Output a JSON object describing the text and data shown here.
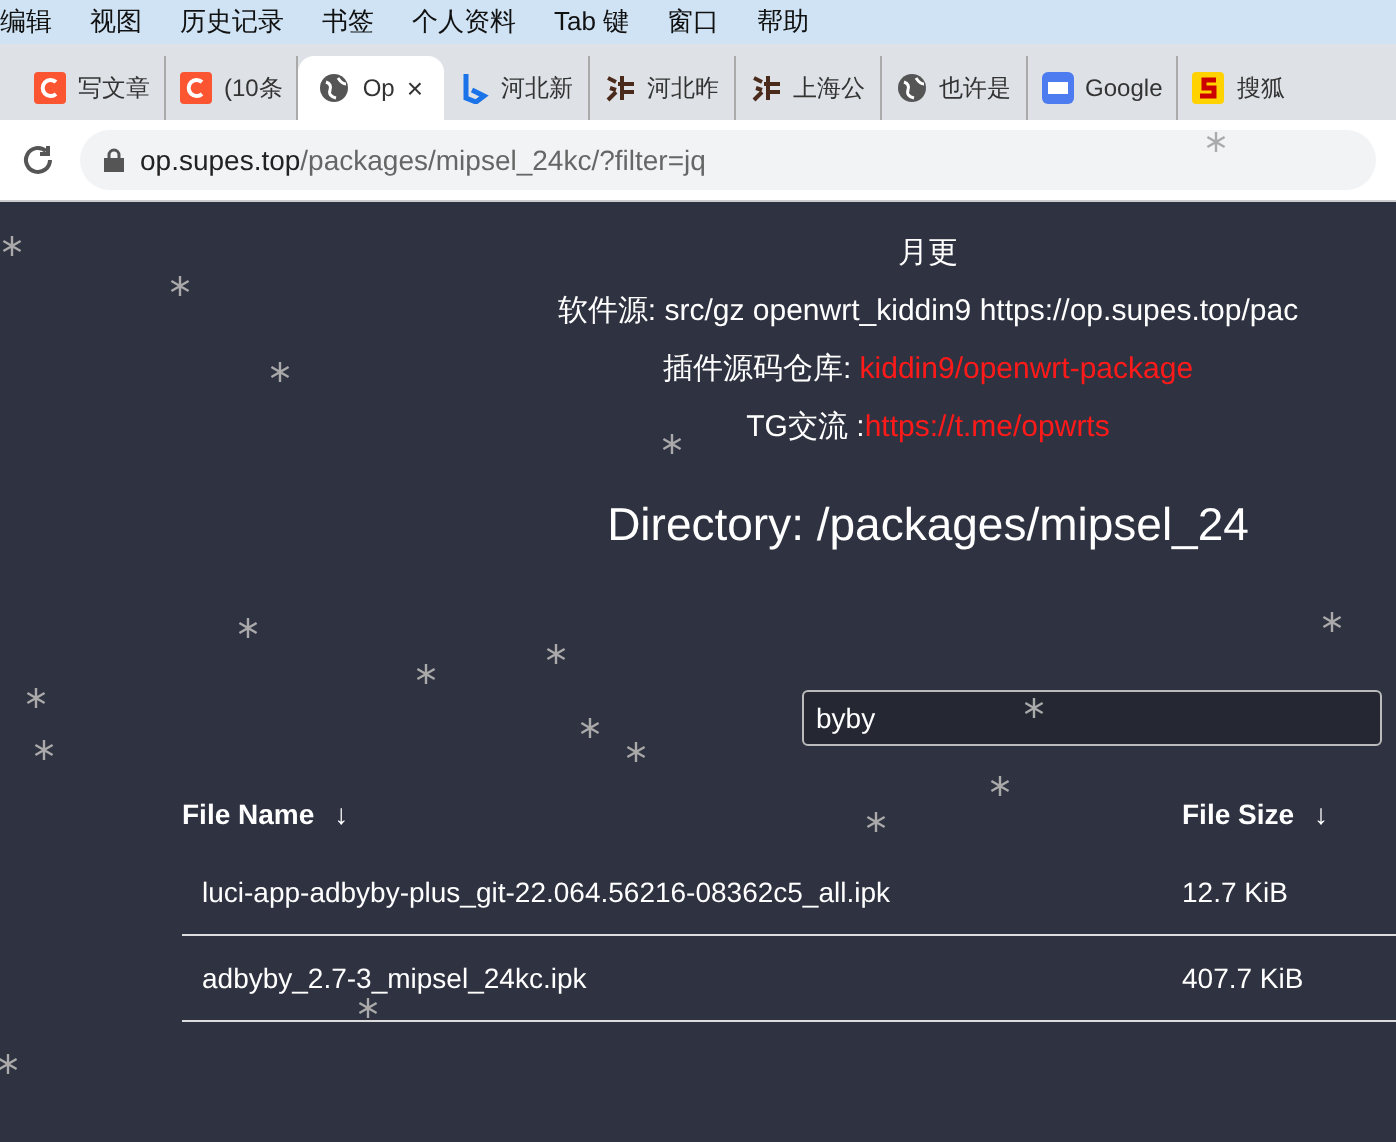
{
  "menu_bar": {
    "items": [
      "编辑",
      "视图",
      "历史记录",
      "书签",
      "个人资料",
      "Tab 键",
      "窗口",
      "帮助"
    ]
  },
  "tabs": [
    {
      "title": "写文章",
      "kind": "c",
      "selected": false
    },
    {
      "title": "(10条",
      "kind": "c",
      "selected": false
    },
    {
      "title": "Op",
      "kind": "globe",
      "selected": true,
      "close": "×"
    },
    {
      "title": "河北新",
      "kind": "b",
      "selected": false
    },
    {
      "title": "河北昨",
      "kind": "ink",
      "selected": false
    },
    {
      "title": "上海公",
      "kind": "ink",
      "selected": false
    },
    {
      "title": "也许是",
      "kind": "globe",
      "selected": false
    },
    {
      "title": "Google",
      "kind": "g",
      "selected": false
    },
    {
      "title": "搜狐",
      "kind": "s",
      "selected": false
    }
  ],
  "address_bar": {
    "host": "op.supes.top",
    "path": "/packages/mipsel_24kc/?filter=jq"
  },
  "header": {
    "update": "月更",
    "source_label": "软件源: ",
    "source_value": "src/gz openwrt_kiddin9 https://op.supes.top/pac",
    "repo_label": "插件源码仓库: ",
    "repo_link": "kiddin9/openwrt-package",
    "tg_label": "TG交流 :",
    "tg_link": "https://t.me/opwrts"
  },
  "directory_title": "Directory: /packages/mipsel_24",
  "search": {
    "value": "byby"
  },
  "table": {
    "columns": [
      {
        "label": "File Name",
        "sort": "↓"
      },
      {
        "label": "File Size",
        "sort": "↓"
      }
    ],
    "rows": [
      {
        "name": "luci-app-adbyby-plus_git-22.064.56216-08362c5_all.ipk",
        "size": "12.7 KiB"
      },
      {
        "name": "adbyby_2.7-3_mipsel_24kc.ipk",
        "size": "407.7 KiB"
      }
    ]
  }
}
